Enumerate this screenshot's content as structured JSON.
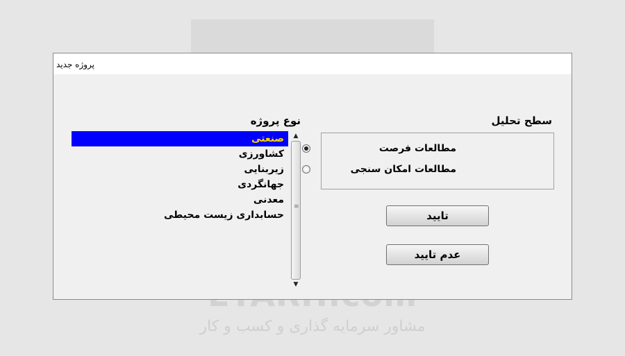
{
  "dialog": {
    "title": "پروژه جدید"
  },
  "project_type": {
    "label": "نوع پروژه",
    "items": [
      {
        "label": "صنعتی",
        "selected": true
      },
      {
        "label": "کشاورزی",
        "selected": false
      },
      {
        "label": "زیربنایی",
        "selected": false
      },
      {
        "label": "جهانگردی",
        "selected": false
      },
      {
        "label": "معدنی",
        "selected": false
      },
      {
        "label": "حسابداری زیست محیطی",
        "selected": false
      }
    ]
  },
  "analysis_level": {
    "label": "سطح تحلیل",
    "options": [
      {
        "label": "مطالعات فرصت",
        "checked": true
      },
      {
        "label": "مطالعات امکان سنجی",
        "checked": false
      }
    ]
  },
  "buttons": {
    "ok": "تایید",
    "cancel": "عدم تایید"
  },
  "watermark": {
    "brand": "ETARH.com",
    "tagline": "مشاور سرمایه گذاری و کسب و کار"
  },
  "colors": {
    "selection_bg": "#0000ff",
    "selection_text": "#ffd400"
  }
}
